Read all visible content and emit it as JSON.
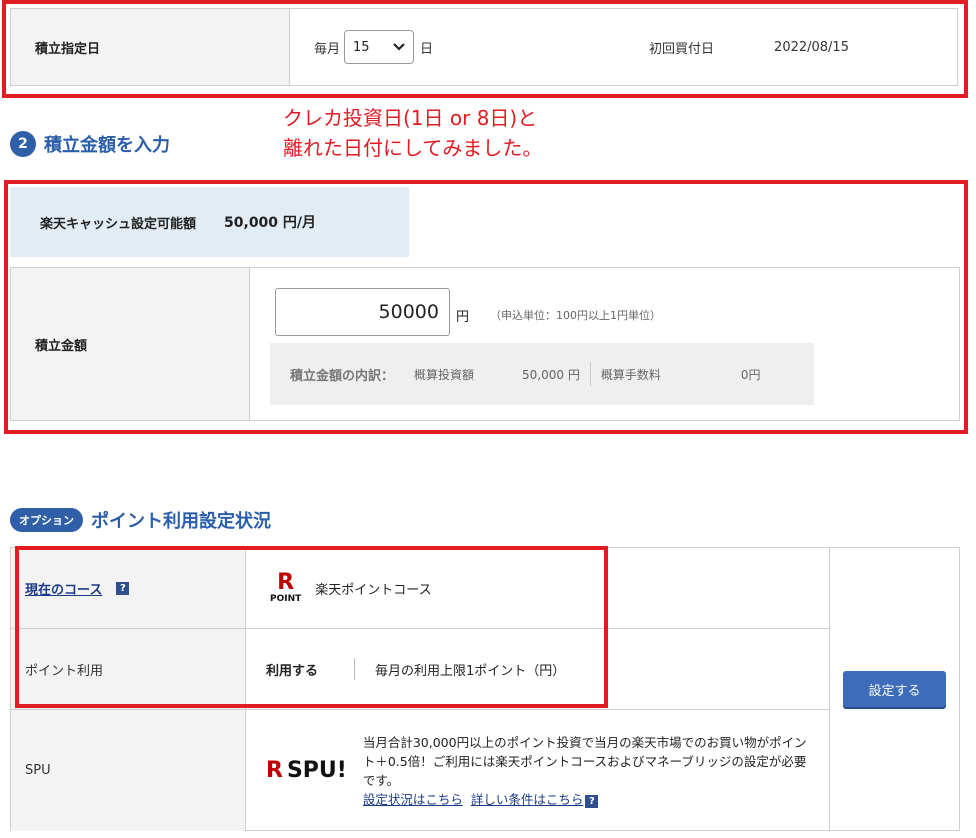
{
  "date_section": {
    "label": "積立指定日",
    "prefix": "毎月",
    "day_value": "15",
    "suffix": "日",
    "first_purchase_label": "初回買付日",
    "first_purchase_date": "2022/08/15"
  },
  "annotation": {
    "line1": "クレカ投資日(1日 or 8日)と",
    "line2": "離れた日付にしてみました。"
  },
  "amount_section": {
    "number": "2",
    "title": "積立金額を入力",
    "cash_label": "楽天キャッシュ設定可能額",
    "cash_value": "50,000 円/月",
    "label": "積立金額",
    "input_value": "50000",
    "unit": "円",
    "note": "（申込単位：100円以上1円単位）",
    "breakdown_label": "積立金額の内訳：",
    "investment_label": "概算投資額",
    "investment_value": "50,000 円",
    "fee_label": "概算手数料",
    "fee_value": "0円"
  },
  "point_section": {
    "option_badge": "オプション",
    "title": "ポイント利用設定状況",
    "course_label": "現在のコース",
    "help_glyph": "?",
    "logo_letter": "R",
    "logo_point": "POINT",
    "course_value": "楽天ポイントコース",
    "use_label": "ポイント利用",
    "use_value": "利用する",
    "use_limit": "毎月の利用上限1ポイント（円）",
    "spu_label": "SPU",
    "spu_logo_r": "R",
    "spu_logo_text": "SPU!",
    "spu_description": "当月合計30,000円以上のポイント投資で当月の楽天市場でのお買い物がポイント＋0.5倍！ご利用には楽天ポイントコースおよびマネーブリッジの設定が必要です。",
    "spu_link_status": "設定状況はこちら",
    "spu_link_details": "詳しい条件はこちら",
    "set_button": "設定する"
  },
  "colors": {
    "annotation_red": "#e31b23",
    "title_blue": "#2b5ea8",
    "button_blue": "#3d6cb8",
    "cash_box_bg": "#e2ecf5",
    "rakuten_red": "#bf0000"
  }
}
